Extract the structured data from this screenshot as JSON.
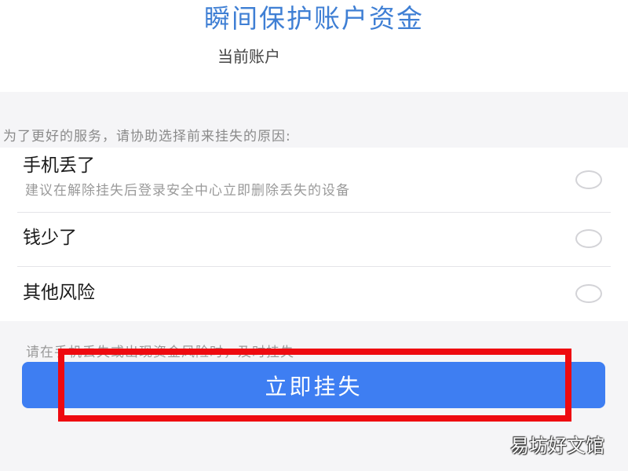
{
  "header": {
    "title": "瞬间保护账户资金",
    "account_label": "当前账户"
  },
  "section_hint": "为了更好的服务，请协助选择前来挂失的原因:",
  "reasons": [
    {
      "title": "手机丢了",
      "desc": "建议在解除挂失后登录安全中心立即删除丢失的设备",
      "selected": false
    },
    {
      "title": "钱少了",
      "desc": "",
      "selected": false
    },
    {
      "title": "其他风险",
      "desc": "",
      "selected": false
    }
  ],
  "footnote": "请在手机丢失或出现资金风险时，及时挂失",
  "submit_label": "立即挂失",
  "annotation": {
    "highlight_color": "#ee0a10"
  },
  "watermark": "易坊好文馆",
  "colors": {
    "accent": "#3e7ef2",
    "title": "#3f7fd4",
    "background": "#f5f5f7"
  }
}
